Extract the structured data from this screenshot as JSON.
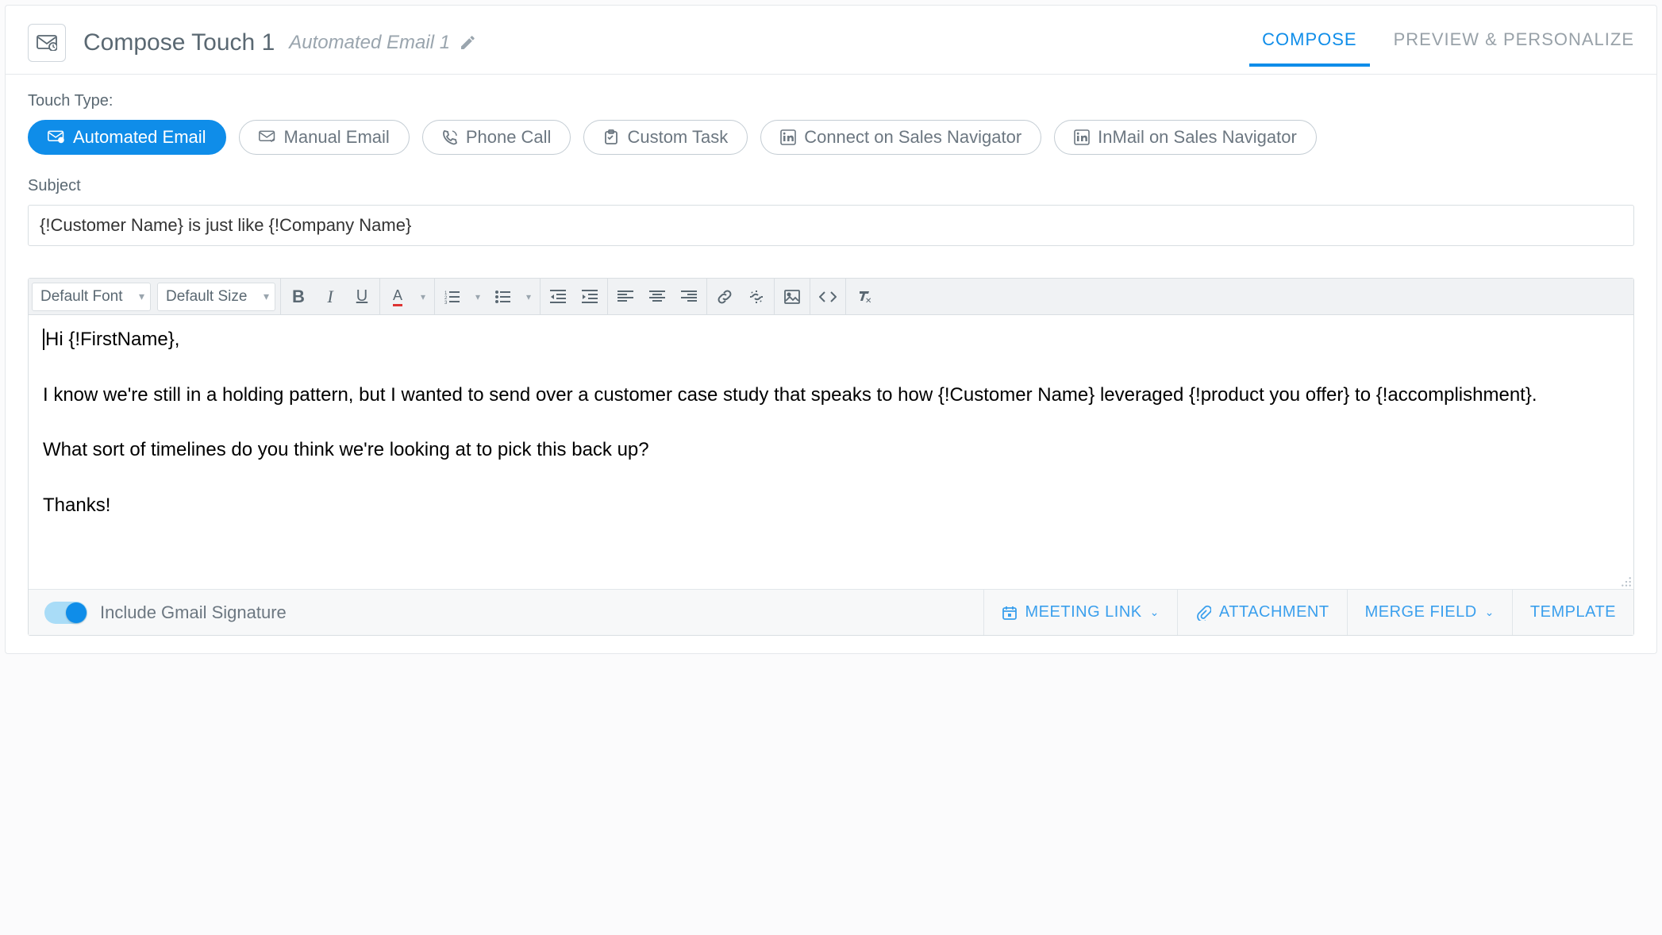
{
  "header": {
    "title": "Compose Touch 1",
    "subtitle": "Automated Email 1"
  },
  "tabs": {
    "compose": "COMPOSE",
    "preview": "PREVIEW & PERSONALIZE"
  },
  "touch_type_label": "Touch Type:",
  "touch_types": [
    {
      "id": "automated-email",
      "label": "Automated Email",
      "icon": "mail-auto",
      "active": true
    },
    {
      "id": "manual-email",
      "label": "Manual Email",
      "icon": "mail-check",
      "active": false
    },
    {
      "id": "phone-call",
      "label": "Phone Call",
      "icon": "phone",
      "active": false
    },
    {
      "id": "custom-task",
      "label": "Custom Task",
      "icon": "task",
      "active": false
    },
    {
      "id": "sn-connect",
      "label": "Connect on Sales Navigator",
      "icon": "linkedin",
      "active": false
    },
    {
      "id": "sn-inmail",
      "label": "InMail on Sales Navigator",
      "icon": "linkedin",
      "active": false
    }
  ],
  "subject": {
    "label": "Subject",
    "value": "{!Customer Name} is just like {!Company Name}"
  },
  "editor_toolbar": {
    "font": "Default Font",
    "size": "Default Size"
  },
  "editor_body": "Hi {!FirstName},\n\nI know we're still in a holding pattern, but I wanted to send over a customer case study that speaks to how {!Customer Name} leveraged {!product you offer} to {!accomplishment}.\n\nWhat sort of timelines do you think we're looking at to pick this back up?\n\nThanks!",
  "footer": {
    "signature_label": "Include Gmail Signature",
    "meeting_link": "MEETING LINK",
    "attachment": "ATTACHMENT",
    "merge_field": "MERGE FIELD",
    "template": "TEMPLATE"
  }
}
